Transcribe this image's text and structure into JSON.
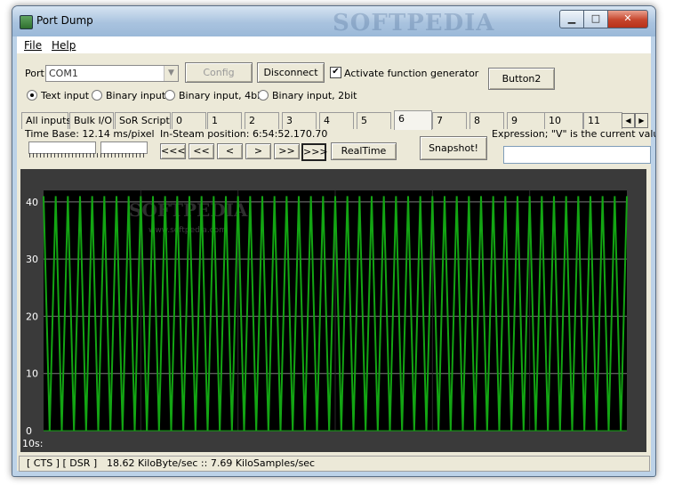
{
  "window": {
    "title": "Port Dump",
    "watermark": "SOFTPEDIA"
  },
  "titlebar": {
    "minimize": "▁",
    "maximize": "□",
    "close": "✕"
  },
  "menu": {
    "file": "File",
    "help": "Help"
  },
  "port": {
    "label": "Port:",
    "value": "COM1",
    "config_label": "Config",
    "disconnect_label": "Disconnect",
    "function_generator_label": "Activate function generator",
    "function_generator_checked": true,
    "button2_label": "Button2"
  },
  "input_modes": [
    {
      "label": "Text input",
      "selected": true
    },
    {
      "label": "Binary input",
      "selected": false
    },
    {
      "label": "Binary input, 4bit",
      "selected": false
    },
    {
      "label": "Binary input, 2bit",
      "selected": false
    }
  ],
  "tabs": [
    "All inputs",
    "Bulk I/O",
    "SoR Script",
    "0",
    "1",
    "2",
    "3",
    "4",
    "5",
    "6",
    "7",
    "8",
    "9",
    "10",
    "11"
  ],
  "active_tab": "6",
  "time_base": "Time Base: 12.14 ms/pixel",
  "stream_position": "In-Steam position: 6:54:52.170.70",
  "nav": [
    "<<<",
    "<<",
    "<",
    ">",
    ">>",
    ">>>"
  ],
  "pressed_nav": ">>>",
  "realtime_label": "RealTime",
  "snapshot_label": "Snapshot!",
  "expression_label": "Expression; \"V\" is the current value",
  "expression_value": "",
  "plot": {
    "y_ticks": [
      "40",
      "30",
      "20",
      "10",
      "0"
    ],
    "x_label": "10s:",
    "watermark": "SOFTPEDIA",
    "watermark_url": "www.softpedia.com",
    "ylim": [
      0,
      42
    ],
    "wave_max": 41,
    "pulse_count": 48,
    "grid_color": "#7a7a7a",
    "trace_color": "#13a513",
    "background": "#000000"
  },
  "status": {
    "signals": "[ CTS ]  [ DSR ]",
    "throughput": "18.62 KiloByte/sec :: 7.69 KiloSamples/sec"
  }
}
